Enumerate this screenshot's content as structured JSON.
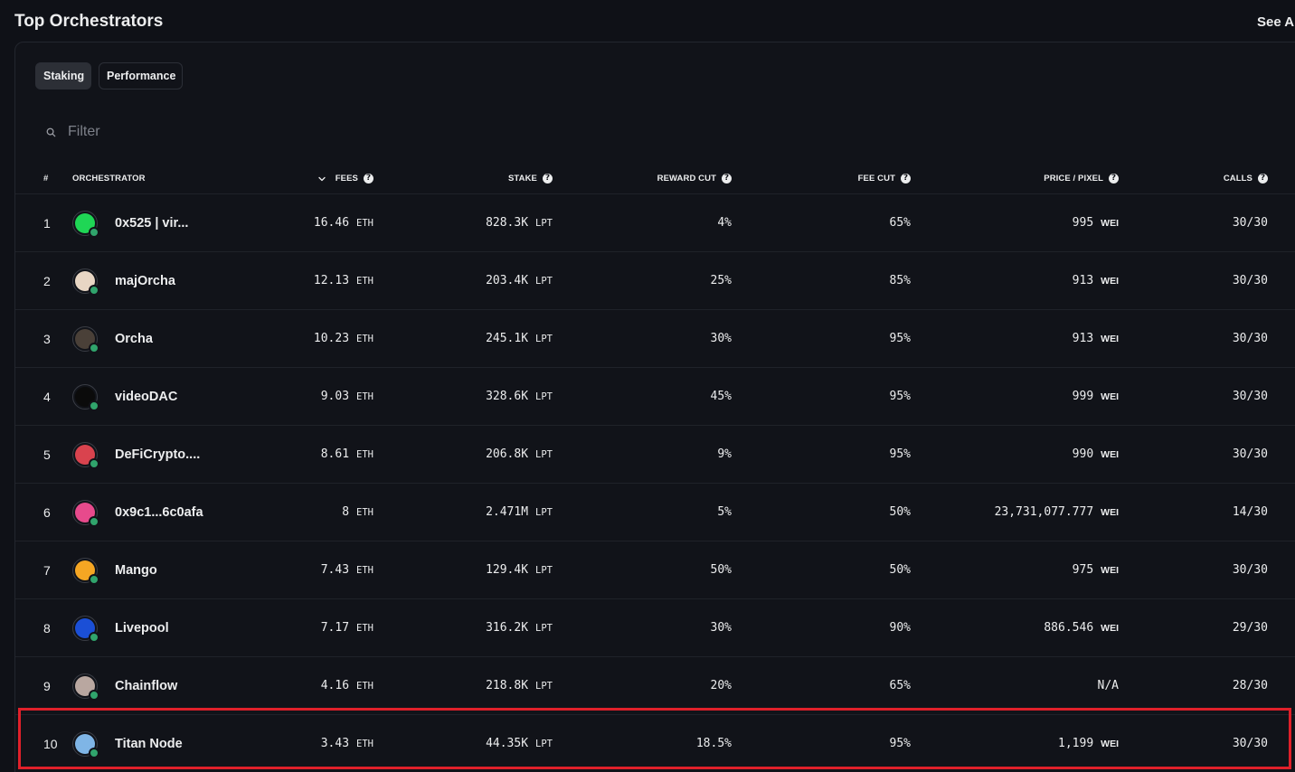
{
  "header": {
    "title": "Top Orchestrators",
    "see_all": "See Al"
  },
  "tabs": [
    {
      "label": "Staking",
      "active": true
    },
    {
      "label": "Performance",
      "active": false
    }
  ],
  "filter": {
    "placeholder": "Filter",
    "value": ""
  },
  "columns": {
    "rank": "#",
    "orchestrator": "ORCHESTRATOR",
    "fees": "FEES",
    "stake": "STAKE",
    "reward_cut": "REWARD CUT",
    "fee_cut": "FEE CUT",
    "price_pixel": "PRICE / PIXEL",
    "calls": "CALLS"
  },
  "rows": [
    {
      "rank": "1",
      "name": "0x525 | vir...",
      "fees": "16.46",
      "fees_unit": "ETH",
      "stake": "828.3K",
      "stake_unit": "LPT",
      "reward_cut": "4%",
      "fee_cut": "65%",
      "price": "995",
      "price_unit": "WEI",
      "calls": "30/30"
    },
    {
      "rank": "2",
      "name": "majOrcha",
      "fees": "12.13",
      "fees_unit": "ETH",
      "stake": "203.4K",
      "stake_unit": "LPT",
      "reward_cut": "25%",
      "fee_cut": "85%",
      "price": "913",
      "price_unit": "WEI",
      "calls": "30/30"
    },
    {
      "rank": "3",
      "name": "Orcha",
      "fees": "10.23",
      "fees_unit": "ETH",
      "stake": "245.1K",
      "stake_unit": "LPT",
      "reward_cut": "30%",
      "fee_cut": "95%",
      "price": "913",
      "price_unit": "WEI",
      "calls": "30/30"
    },
    {
      "rank": "4",
      "name": "videoDAC",
      "fees": "9.03",
      "fees_unit": "ETH",
      "stake": "328.6K",
      "stake_unit": "LPT",
      "reward_cut": "45%",
      "fee_cut": "95%",
      "price": "999",
      "price_unit": "WEI",
      "calls": "30/30"
    },
    {
      "rank": "5",
      "name": "DeFiCrypto....",
      "fees": "8.61",
      "fees_unit": "ETH",
      "stake": "206.8K",
      "stake_unit": "LPT",
      "reward_cut": "9%",
      "fee_cut": "95%",
      "price": "990",
      "price_unit": "WEI",
      "calls": "30/30"
    },
    {
      "rank": "6",
      "name": "0x9c1...6c0afa",
      "fees": "8",
      "fees_unit": "ETH",
      "stake": "2.471M",
      "stake_unit": "LPT",
      "reward_cut": "5%",
      "fee_cut": "50%",
      "price": "23,731,077.777",
      "price_unit": "WEI",
      "calls": "14/30"
    },
    {
      "rank": "7",
      "name": "Mango",
      "fees": "7.43",
      "fees_unit": "ETH",
      "stake": "129.4K",
      "stake_unit": "LPT",
      "reward_cut": "50%",
      "fee_cut": "50%",
      "price": "975",
      "price_unit": "WEI",
      "calls": "30/30"
    },
    {
      "rank": "8",
      "name": "Livepool",
      "fees": "7.17",
      "fees_unit": "ETH",
      "stake": "316.2K",
      "stake_unit": "LPT",
      "reward_cut": "30%",
      "fee_cut": "90%",
      "price": "886.546",
      "price_unit": "WEI",
      "calls": "29/30"
    },
    {
      "rank": "9",
      "name": "Chainflow",
      "fees": "4.16",
      "fees_unit": "ETH",
      "stake": "218.8K",
      "stake_unit": "LPT",
      "reward_cut": "20%",
      "fee_cut": "65%",
      "price": "N/A",
      "price_unit": "",
      "calls": "28/30"
    },
    {
      "rank": "10",
      "name": "Titan Node",
      "fees": "3.43",
      "fees_unit": "ETH",
      "stake": "44.35K",
      "stake_unit": "LPT",
      "reward_cut": "18.5%",
      "fee_cut": "95%",
      "price": "1,199",
      "price_unit": "WEI",
      "calls": "30/30"
    }
  ],
  "avatar_colors": [
    "#1fd655",
    "#e8d6c4",
    "#4a4038",
    "#0b0b0b",
    "#d9434e",
    "#e74a8c",
    "#f5a623",
    "#1b4fd6",
    "#b9a7a0",
    "#7fb5e6"
  ],
  "avatar_icons": [
    "green-circle-icon",
    "pattern-avatar-icon",
    "portrait-avatar-icon",
    "play-logo-icon",
    "chain-link-icon",
    "pattern-avatar-icon",
    "mango-logo-icon",
    "livepool-logo-icon",
    "portrait-avatar-icon",
    "titan-logo-icon"
  ],
  "status_color": "#30a46c",
  "highlight_color": "#e0202a"
}
